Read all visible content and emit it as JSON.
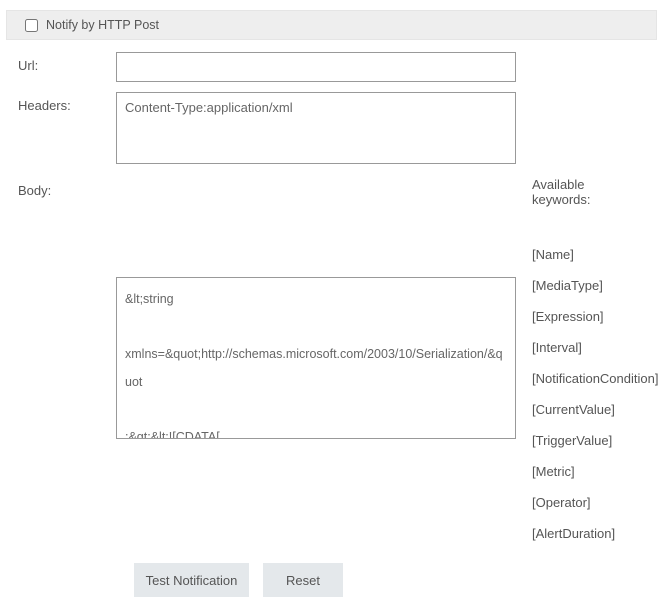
{
  "header": {
    "checkbox_label": "Notify by HTTP Post",
    "checked": false
  },
  "form": {
    "url": {
      "label": "Url:",
      "value": ""
    },
    "headers": {
      "label": "Headers:",
      "value": "Content-Type:application/xml"
    },
    "body": {
      "label": "Body:",
      "value": "&lt;string\n\nxmlns=&quot;http://schemas.microsoft.com/2003/10/Serialization/&quot\n\n;&gt;&lt;![CDATA[\n\n\nExpression=[Expression]&amp;Metric=[Metric]&amp;CurrentValue=\n\n[CurrentValue]&amp;NotificationCondition=[NotificationCondition]"
    }
  },
  "keywords": {
    "title": "Available keywords:",
    "items": [
      "[Name]",
      "[MediaType]",
      "[Expression]",
      "[Interval]",
      "[NotificationCondition]",
      "[CurrentValue]",
      "[TriggerValue]",
      "[Metric]",
      "[Operator]",
      "[AlertDuration]"
    ]
  },
  "buttons": {
    "test": "Test Notification",
    "reset": "Reset"
  }
}
